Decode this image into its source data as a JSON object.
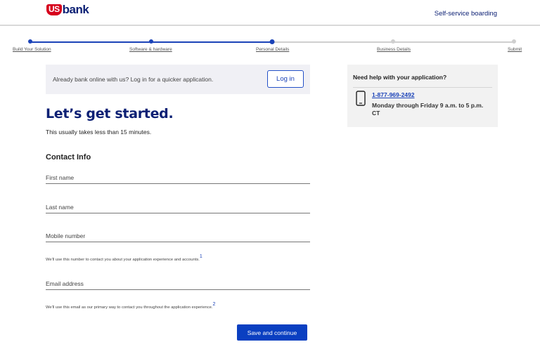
{
  "header": {
    "logo_us": "US",
    "logo_bank": "bank",
    "link": "Self-service boarding"
  },
  "progress": {
    "steps": [
      {
        "label": "Build Your Solution",
        "status": "done"
      },
      {
        "label": "Software & hardware",
        "status": "done"
      },
      {
        "label": "Personal Details",
        "status": "current"
      },
      {
        "label": "Business Details",
        "status": "todo"
      },
      {
        "label": "Submit",
        "status": "todo"
      }
    ]
  },
  "login_banner": {
    "text": "Already bank online with us?  Log in for a quicker application.",
    "button": "Log in"
  },
  "help": {
    "title": "Need help with your application?",
    "phone": "1-877-969-2492",
    "hours": "Monday through Friday 9 a.m. to 5 p.m. CT",
    "icon": "phone-icon"
  },
  "main": {
    "title": "Let’s get started.",
    "subtitle": "This usually takes less than 15 minutes.",
    "section": "Contact Info",
    "fields": {
      "first_name": {
        "label": "First name",
        "value": ""
      },
      "last_name": {
        "label": "Last name",
        "value": ""
      },
      "mobile": {
        "label": "Mobile number",
        "value": ""
      },
      "email": {
        "label": "Email address",
        "value": ""
      }
    },
    "mobile_hint": "We'll use this number to contact you about your application experience and accounts.",
    "mobile_hint_ref": "1",
    "email_hint": "We'll use this email as our primary way to contact you throughout the application experience.",
    "email_hint_ref": "2",
    "submit": "Save and continue"
  },
  "colors": {
    "brand_navy": "#0c2074",
    "brand_red": "#d6001c",
    "accent_blue": "#0a3fc1"
  }
}
